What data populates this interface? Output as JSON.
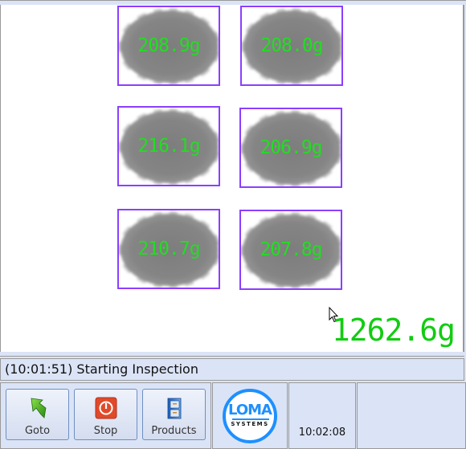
{
  "inspection": {
    "items": [
      {
        "weight": "208.9g"
      },
      {
        "weight": "208.0g"
      },
      {
        "weight": "216.1g"
      },
      {
        "weight": "206.9g"
      },
      {
        "weight": "210.7g"
      },
      {
        "weight": "207.8g"
      }
    ],
    "total_weight": "1262.6g",
    "box_color": "#8b3fff",
    "text_color": "#22dd22"
  },
  "status": {
    "message": "(10:01:51) Starting Inspection"
  },
  "toolbar": {
    "buttons": [
      {
        "label": "Goto",
        "icon": "goto-arrow-icon"
      },
      {
        "label": "Stop",
        "icon": "stop-power-icon"
      },
      {
        "label": "Products",
        "icon": "filing-cabinet-icon"
      }
    ]
  },
  "logo": {
    "name": "LOMA",
    "tagline": "SYSTEMS"
  },
  "clock": {
    "time": "10:02:08"
  }
}
